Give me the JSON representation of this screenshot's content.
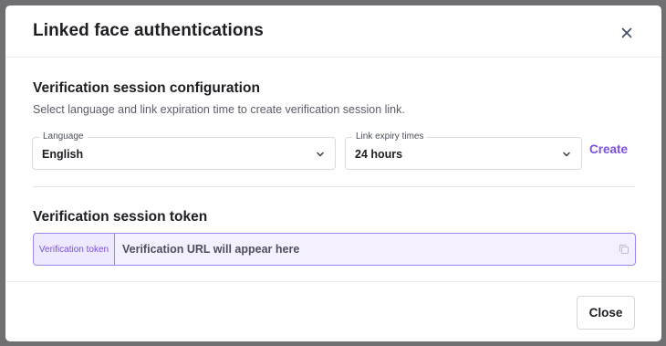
{
  "modal": {
    "title": "Linked face authentications",
    "close_icon": "close-icon"
  },
  "config_section": {
    "title": "Verification session configuration",
    "subtitle": "Select language and link expiration time to create verification session link.",
    "language": {
      "label": "Language",
      "value": "English"
    },
    "expiry": {
      "label": "Link expiry times",
      "value": "24 hours"
    },
    "create_label": "Create"
  },
  "token_section": {
    "title": "Verification session token",
    "addon_label": "Verification token",
    "placeholder": "Verification URL will appear here",
    "copy_icon": "copy-icon"
  },
  "footer": {
    "close_label": "Close"
  },
  "colors": {
    "accent": "#7b4fe0",
    "overlay": "#6f6f72",
    "token_bg": "#f4f0ff"
  }
}
